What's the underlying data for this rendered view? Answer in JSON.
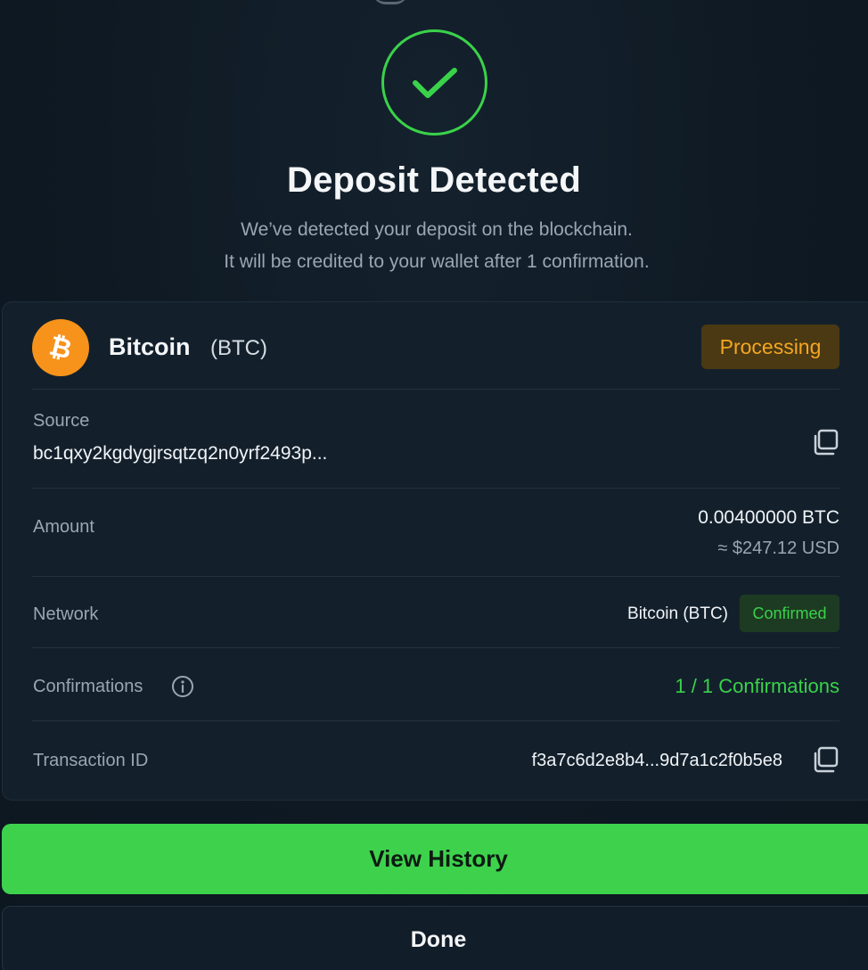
{
  "header": {
    "title": "Deposit Detected",
    "subtitle_line1": "We’ve detected your deposit on the blockchain.",
    "subtitle_line2": "It will be credited to your wallet after 1 confirmation."
  },
  "asset": {
    "name": "Bitcoin",
    "symbol": "(BTC)",
    "icon": "bitcoin-icon",
    "status": "Processing"
  },
  "details": {
    "source": {
      "label": "Source",
      "value": "bc1qxy2kgdygjrsqtzq2n0yrf2493p..."
    },
    "amount": {
      "label": "Amount",
      "value": "0.00400000 BTC",
      "fiat": "≈ $247.12 USD"
    },
    "network": {
      "label": "Network",
      "value": "Bitcoin (BTC)",
      "badge": "Confirmed"
    },
    "confirmations": {
      "label": "Confirmations",
      "value": "1 / 1 Confirmations"
    },
    "transaction": {
      "label": "Transaction ID",
      "value": "f3a7c6d2e8b4...9d7a1c2f0b5e8"
    }
  },
  "actions": {
    "primary": "View History",
    "secondary": "Done"
  },
  "colors": {
    "accent_green": "#3ed24c",
    "processing_orange": "#f5a623",
    "bitcoin_orange": "#f7931a",
    "background": "#0f1923"
  }
}
